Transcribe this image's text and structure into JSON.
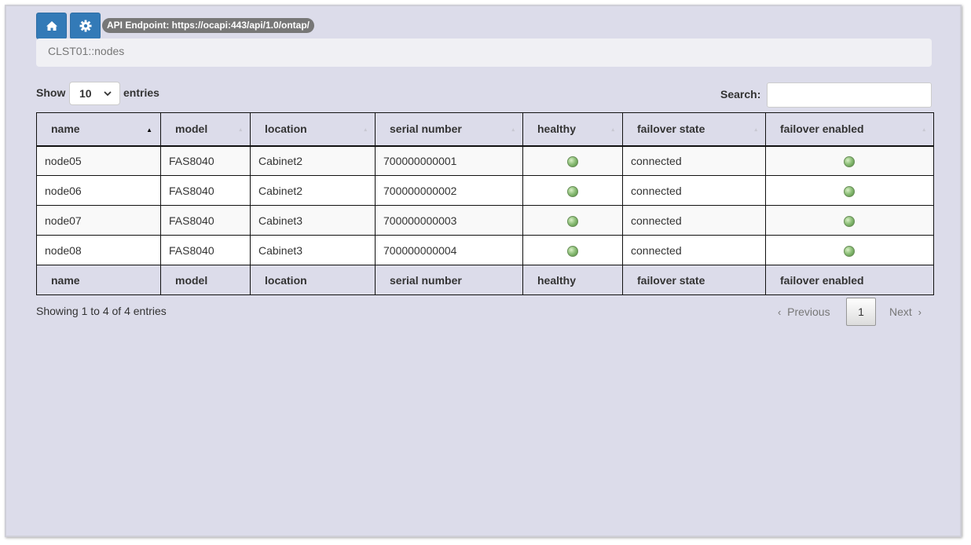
{
  "toolbar": {
    "home_icon": "home-icon",
    "settings_icon": "gear-icon",
    "endpoint_label": "API Endpoint: https://ocapi:443/api/1.0/ontap/"
  },
  "breadcrumb": "CLST01::nodes",
  "length_menu": {
    "show_label": "Show",
    "value": "10",
    "entries_label": "entries"
  },
  "search": {
    "label": "Search:",
    "value": "",
    "placeholder": ""
  },
  "table": {
    "columns": [
      "name",
      "model",
      "location",
      "serial number",
      "healthy",
      "failover state",
      "failover enabled"
    ],
    "sorted_column": "name",
    "rows": [
      {
        "name": "node05",
        "model": "FAS8040",
        "location": "Cabinet2",
        "serial": "700000000001",
        "healthy": "green",
        "failover_state": "connected",
        "failover_enabled": "green"
      },
      {
        "name": "node06",
        "model": "FAS8040",
        "location": "Cabinet2",
        "serial": "700000000002",
        "healthy": "green",
        "failover_state": "connected",
        "failover_enabled": "green"
      },
      {
        "name": "node07",
        "model": "FAS8040",
        "location": "Cabinet3",
        "serial": "700000000003",
        "healthy": "green",
        "failover_state": "connected",
        "failover_enabled": "green"
      },
      {
        "name": "node08",
        "model": "FAS8040",
        "location": "Cabinet3",
        "serial": "700000000004",
        "healthy": "green",
        "failover_state": "connected",
        "failover_enabled": "green"
      }
    ]
  },
  "info": "Showing 1 to 4 of 4 entries",
  "pagination": {
    "previous": "Previous",
    "current": "1",
    "next": "Next"
  },
  "colors": {
    "background": "#dcdcea",
    "button": "#337ab7",
    "status_green": "#8fc07a"
  }
}
